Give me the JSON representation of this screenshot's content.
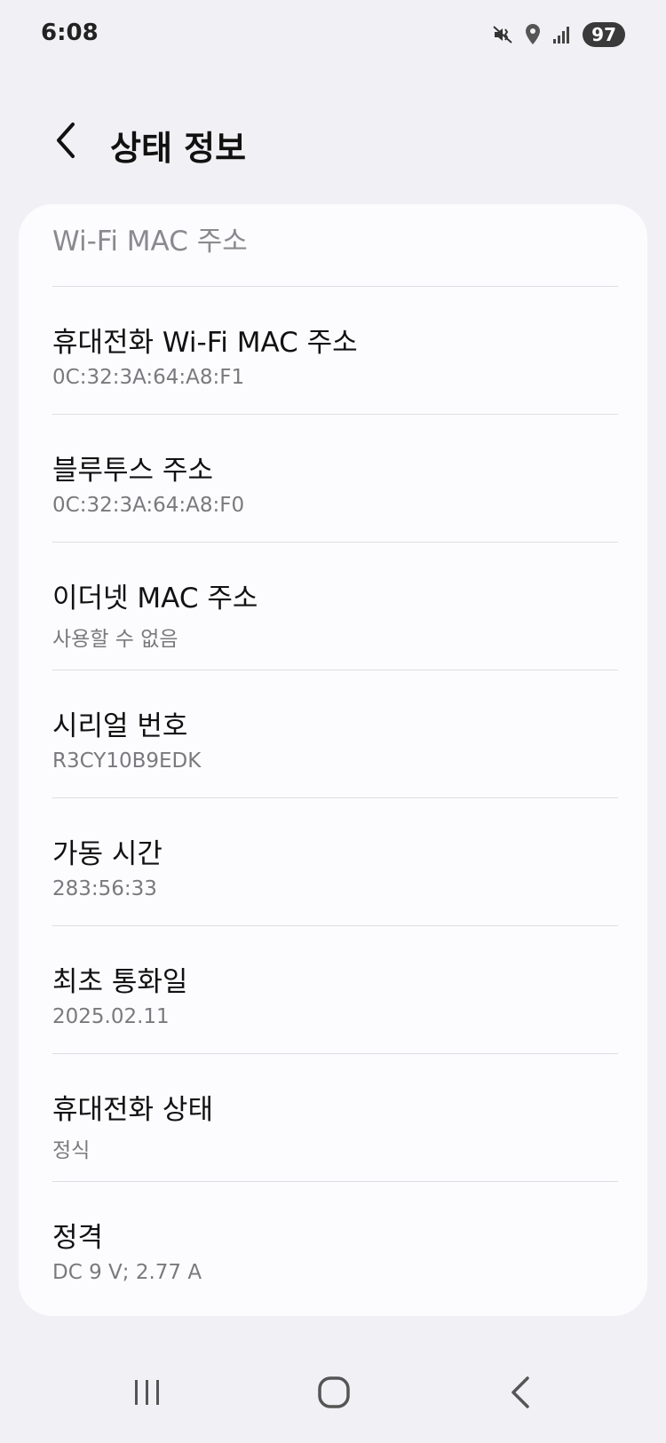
{
  "status_bar": {
    "time": "6:08",
    "battery": "97",
    "icons": [
      "mute-vibrate-icon",
      "location-icon",
      "signal-icon",
      "battery-icon"
    ]
  },
  "header": {
    "title": "상태 정보",
    "back_icon": "chevron-left-icon"
  },
  "partial_item": "Wi-Fi MAC 주소",
  "items": [
    {
      "title": "휴대전화 Wi-Fi MAC 주소",
      "value": "0C:32:3A:64:A8:F1"
    },
    {
      "title": "블루투스 주소",
      "value": "0C:32:3A:64:A8:F0"
    },
    {
      "title": "이더넷 MAC 주소",
      "value": "사용할 수 없음"
    },
    {
      "title": "시리얼 번호",
      "value": "R3CY10B9EDK"
    },
    {
      "title": "가동 시간",
      "value": "283:56:33"
    },
    {
      "title": "최초 통화일",
      "value": "2025.02.11"
    },
    {
      "title": "휴대전화 상태",
      "value": "정식"
    },
    {
      "title": "정격",
      "value": "DC 9 V; 2.77 A"
    }
  ],
  "nav_bar": {
    "icons": [
      "recent-apps-icon",
      "home-icon",
      "back-icon"
    ]
  },
  "colors": {
    "background": "#f1f1f5",
    "card": "#fcfcfe",
    "primary_text": "#111111",
    "secondary_text": "#7a7a7e"
  }
}
